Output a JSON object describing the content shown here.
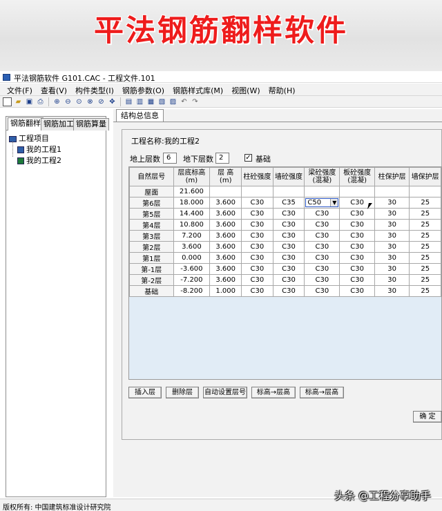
{
  "banner": {
    "title": "平法钢筋翻样软件"
  },
  "window": {
    "title": "平法钢筋软件 G101.CAC - 工程文件.101"
  },
  "menu": [
    "文件(F)",
    "查看(V)",
    "构件类型(I)",
    "钢筋参数(O)",
    "钢筋样式库(M)",
    "视图(W)",
    "帮助(H)"
  ],
  "toolbar": {
    "icons": [
      "new-file-icon",
      "open-folder-icon",
      "save-icon",
      "print-icon",
      "zoom-in-icon",
      "zoom-out-icon",
      "zoom-fit-icon",
      "zoom-window-icon",
      "zoom-previous-icon",
      "pan-icon",
      "page-icon",
      "page-plus-icon",
      "page-list-icon",
      "page-edit-icon",
      "undo-icon",
      "redo-icon"
    ]
  },
  "left_panel": {
    "tabs": [
      "钢筋翻样",
      "钢筋加工",
      "钢筋算量"
    ],
    "tree": {
      "root": "工程项目",
      "children": [
        "我的工程1",
        "我的工程2"
      ]
    }
  },
  "right_panel": {
    "tab": "结构总信息",
    "project_name_label": "工程名称:",
    "project_name_value": "我的工程2",
    "above_label": "地上层数",
    "above_value": "6",
    "below_label": "地下层数",
    "below_value": "2",
    "foundation_label": "基础",
    "foundation_checked": true
  },
  "grid": {
    "headers": [
      "自然层号",
      "层底标高\n(m)",
      "层  高\n(m)",
      "柱砼强度",
      "墙砼强度",
      "梁砼强度\n(混凝)",
      "板砼强度\n(混凝)",
      "柱保护层",
      "墙保护层"
    ],
    "rows": [
      [
        "屋面",
        "21.600",
        "",
        "",
        "",
        "",
        "",
        "",
        ""
      ],
      [
        "第6层",
        "18.000",
        "3.600",
        "C30",
        "C35",
        "C50",
        "C30",
        "30",
        "25"
      ],
      [
        "第5层",
        "14.400",
        "3.600",
        "C30",
        "C30",
        "C30",
        "C30",
        "30",
        "25"
      ],
      [
        "第4层",
        "10.800",
        "3.600",
        "C30",
        "C30",
        "C30",
        "C30",
        "30",
        "25"
      ],
      [
        "第3层",
        "7.200",
        "3.600",
        "C30",
        "C30",
        "C30",
        "C30",
        "30",
        "25"
      ],
      [
        "第2层",
        "3.600",
        "3.600",
        "C30",
        "C30",
        "C30",
        "C30",
        "30",
        "25"
      ],
      [
        "第1层",
        "0.000",
        "3.600",
        "C30",
        "C30",
        "C30",
        "C30",
        "30",
        "25"
      ],
      [
        "第-1层",
        "-3.600",
        "3.600",
        "C30",
        "C30",
        "C30",
        "C30",
        "30",
        "25"
      ],
      [
        "第-2层",
        "-7.200",
        "3.600",
        "C30",
        "C30",
        "C30",
        "C30",
        "30",
        "25"
      ],
      [
        "基础",
        "-8.200",
        "1.000",
        "C30",
        "C30",
        "C30",
        "C30",
        "30",
        "25"
      ]
    ]
  },
  "buttons": {
    "insert_floor": "插入层",
    "delete_floor": "删除层",
    "auto_floor_no": "自动设置层号",
    "elev_to_height": "标高→层高",
    "height_to_elev": "标高→层高",
    "ok": "确 定"
  },
  "status": {
    "text": "版权所有:  中国建筑标准设计研究院"
  },
  "watermark": "头条 @工程分享助手"
}
